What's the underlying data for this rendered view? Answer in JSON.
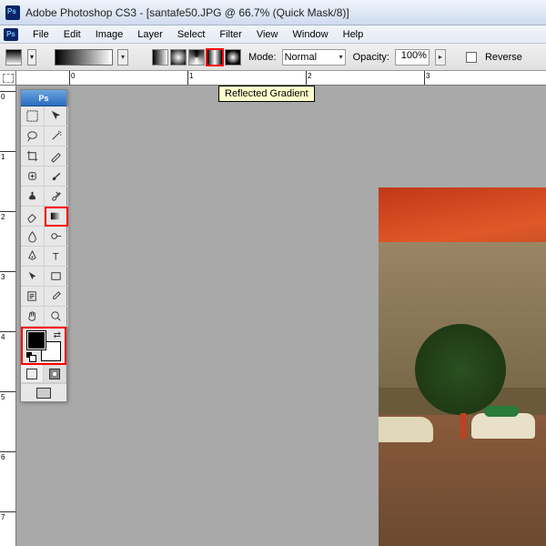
{
  "title": "Adobe Photoshop CS3 - [santafe50.JPG @ 66.7% (Quick Mask/8)]",
  "logo_text": "Ps",
  "menu": {
    "file": "File",
    "edit": "Edit",
    "image": "Image",
    "layer": "Layer",
    "select": "Select",
    "filter": "Filter",
    "view": "View",
    "window": "Window",
    "help": "Help"
  },
  "options": {
    "mode_label": "Mode:",
    "mode_value": "Normal",
    "opacity_label": "Opacity:",
    "opacity_value": "100%",
    "reverse_label": "Reverse"
  },
  "tooltip": "Reflected Gradient",
  "ruler_h": [
    "0",
    "1",
    "2",
    "3"
  ],
  "ruler_v": [
    "0",
    "1",
    "2",
    "3",
    "4",
    "5",
    "6",
    "7"
  ]
}
